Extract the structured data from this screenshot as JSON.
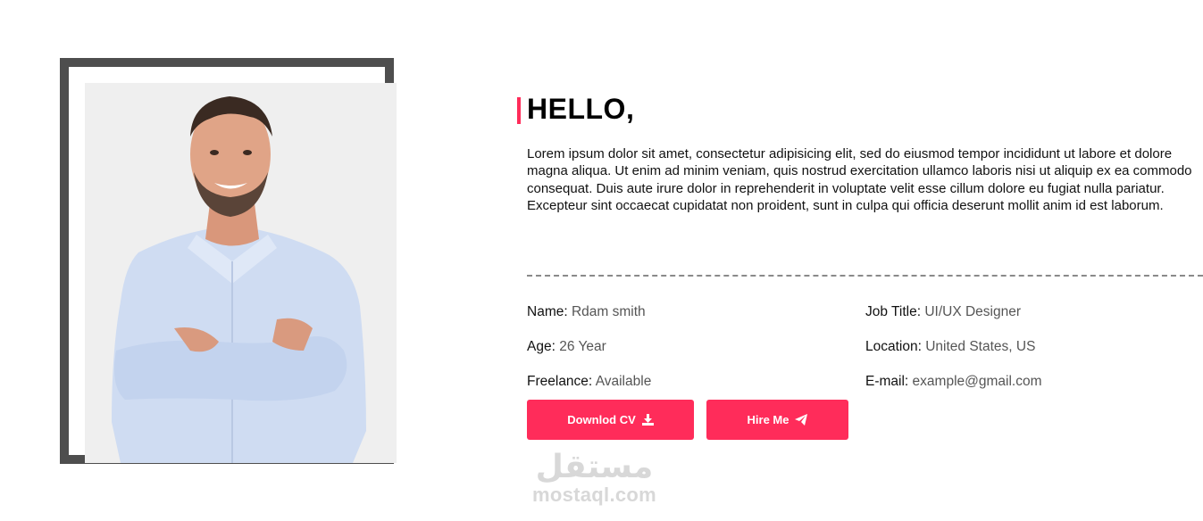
{
  "intro": {
    "heading": "HELLO,",
    "bio": "Lorem ipsum dolor sit amet, consectetur adipisicing elit, sed do eiusmod tempor incididunt ut labore et dolore magna aliqua. Ut enim ad minim veniam, quis nostrud exercitation ullamco laboris nisi ut aliquip ex ea commodo consequat. Duis aute irure dolor in reprehenderit in voluptate velit esse cillum dolore eu fugiat nulla pariatur. Excepteur sint occaecat cupidatat non proident, sunt in culpa qui officia deserunt mollit anim id est laborum."
  },
  "details": {
    "name": {
      "label": "Name:",
      "value": "Rdam smith"
    },
    "age": {
      "label": "Age:",
      "value": "26 Year"
    },
    "freelance": {
      "label": "Freelance:",
      "value": "Available"
    },
    "job_title": {
      "label": "Job Title:",
      "value": "UI/UX Designer"
    },
    "location": {
      "label": "Location:",
      "value": "United States, US"
    },
    "email": {
      "label": "E-mail:",
      "value": "example@gmail.com"
    }
  },
  "buttons": {
    "download": {
      "label": "Downlod CV",
      "icon": "download-icon"
    },
    "hire": {
      "label": "Hire Me",
      "icon": "paper-plane-icon"
    }
  },
  "watermark": {
    "arabic": "مستقل",
    "latin": "mostaql.com"
  },
  "colors": {
    "accent": "#ff2c5a",
    "frame": "#4e4e4e",
    "photo_bg": "#efefef"
  }
}
